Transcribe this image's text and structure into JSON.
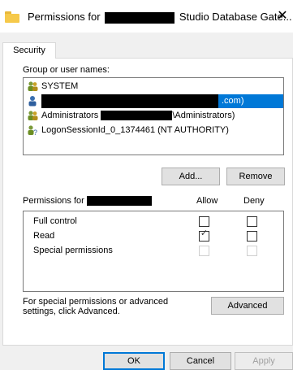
{
  "window": {
    "title_prefix": "Permissions for",
    "title_suffix": "Studio Database Gate...",
    "close_glyph": "✕"
  },
  "tabs": {
    "active": "Security"
  },
  "group_names": {
    "label": "Group or user names:",
    "items": [
      {
        "text": "SYSTEM",
        "icon": "group-icon"
      },
      {
        "text": ".com)",
        "icon": "user-icon",
        "selected": true
      },
      {
        "text_before": "Administrators",
        "text_after": "\\Administrators)",
        "icon": "group-icon"
      },
      {
        "text": "LogonSessionId_0_1374461 (NT AUTHORITY)",
        "icon": "unknown-user-icon"
      }
    ]
  },
  "buttons": {
    "add": "Add...",
    "remove": "Remove",
    "advanced": "Advanced",
    "ok": "OK",
    "cancel": "Cancel",
    "apply": "Apply"
  },
  "permissions": {
    "label": "Permissions for",
    "allow_header": "Allow",
    "deny_header": "Deny",
    "rows": [
      {
        "name": "Full control",
        "allow": false,
        "deny": false,
        "enabled": true
      },
      {
        "name": "Read",
        "allow": true,
        "deny": false,
        "enabled": true
      },
      {
        "name": "Special permissions",
        "allow": false,
        "deny": false,
        "enabled": false
      }
    ]
  },
  "advanced_text": "For special permissions or advanced settings, click Advanced.",
  "colors": {
    "selection": "#0078d7",
    "dialog_bg": "#f0f0f0"
  }
}
